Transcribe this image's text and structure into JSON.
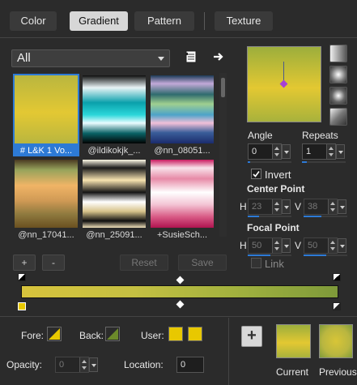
{
  "tabs": [
    {
      "label": "Color"
    },
    {
      "label": "Gradient"
    },
    {
      "label": "Pattern"
    },
    {
      "label": "Texture"
    }
  ],
  "category": {
    "selected": "All"
  },
  "thumbnails": [
    {
      "label": "# L&K 1 Vo..."
    },
    {
      "label": "@ildikokjk_..."
    },
    {
      "label": "@nn_08051..."
    },
    {
      "label": "@nn_17041..."
    },
    {
      "label": "@nn_25091..."
    },
    {
      "label": "+SusieSch..."
    }
  ],
  "buttons": {
    "add": "+",
    "remove": "-",
    "reset": "Reset",
    "save": "Save"
  },
  "angle": {
    "label": "Angle",
    "value": "0"
  },
  "repeats": {
    "label": "Repeats",
    "value": "1"
  },
  "invert": {
    "label": "Invert",
    "checked": true
  },
  "center_point": {
    "label": "Center Point",
    "h_label": "H",
    "h_value": "23",
    "v_label": "V",
    "v_value": "38"
  },
  "focal_point": {
    "label": "Focal Point",
    "h_label": "H",
    "h_value": "50",
    "v_label": "V",
    "v_value": "50"
  },
  "link": {
    "label": "Link",
    "checked": false
  },
  "bottom": {
    "fore_label": "Fore:",
    "back_label": "Back:",
    "user_label": "User:",
    "opacity_label": "Opacity:",
    "opacity_value": "0",
    "location_label": "Location:",
    "location_value": "0",
    "current_label": "Current",
    "previous_label": "Previous",
    "add_button": "+"
  },
  "colors": {
    "accent": "#2d7ad6",
    "gold": "#e8c800",
    "olive": "#6c8a2a",
    "gradient_light": "#c9c845",
    "gradient_dark": "#7e9a3a"
  }
}
